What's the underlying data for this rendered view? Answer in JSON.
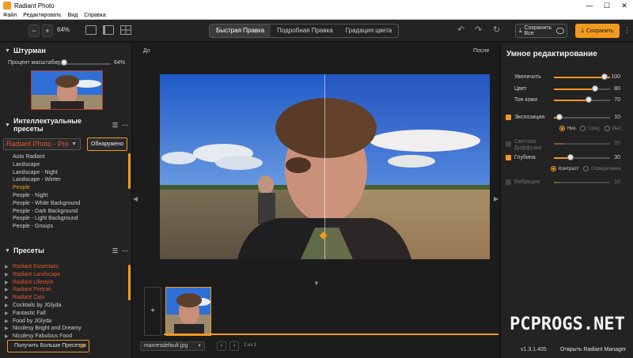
{
  "titlebar": {
    "title": "Radiant Photo",
    "minimize": "—",
    "maximize": "☐",
    "close": "✕"
  },
  "menu": [
    "Файл",
    "Редактировать",
    "Вид",
    "Справка"
  ],
  "toolbar": {
    "zoom_out": "−",
    "zoom_in": "+",
    "zoom_value": "64%",
    "tabs": [
      "Быстрая Правка",
      "Подробная Правка",
      "Градация цвета"
    ],
    "save_all_label": "Сохранить Все",
    "save_label": "Сохранить",
    "more": "⋮"
  },
  "navigator": {
    "title": "Штурман",
    "scale_label": "Процент масштабир",
    "scale_value": "64%",
    "scale_level": 0.1
  },
  "smart_presets": {
    "title": "Интеллектуальные пресеты",
    "selected_pack": "Radiant Photo - Pro",
    "update_button": "Обнаружено",
    "items": [
      "Auto Radiant",
      "Landscape",
      "Landscape - Night",
      "Landscape - Winter",
      "People",
      "People - Night",
      "People - White Background",
      "People - Dark Background",
      "People - Light Background",
      "People - Groups"
    ],
    "selected_index": 4
  },
  "presets": {
    "title": "Пресеты",
    "items": [
      "Radiant Essentials",
      "Radiant Landscape",
      "Radiant Lifestyle",
      "Radiant Portrait",
      "Radiant Cats",
      "Cocktails by JGlyda",
      "Fantastic Fall",
      "Food by JGlyda",
      "Nicolesy Bright and Dreamy",
      "Nicolesy Fabulous Food"
    ],
    "highlighted": [
      0,
      1,
      2,
      3,
      4
    ],
    "more_button": "Получить Больше Пресетов"
  },
  "canvas": {
    "before_label": "До",
    "after_label": "После",
    "file_name": "maxresdefault.jpg",
    "page_text": "1 из 1",
    "add_label": "+"
  },
  "smart_edit": {
    "title": "Умное редактирование",
    "sliders": [
      {
        "label": "Увеличить",
        "value": "100",
        "level": 1.0
      },
      {
        "label": "Цвет",
        "value": "80",
        "level": 0.8
      },
      {
        "label": "Тон кожи",
        "value": "70",
        "level": 0.7
      }
    ],
    "exposure": {
      "label": "Экспозиция",
      "value": "10",
      "level": 0.1,
      "checked": true
    },
    "exposure_modes": [
      "Низ.",
      "Сред.",
      "Выс."
    ],
    "light_diffusion": {
      "label_line1": "Светлая",
      "label_line2": "Диффузия",
      "value": "20",
      "level": 0.2,
      "checked": false
    },
    "depth": {
      "label": "Глубина",
      "value": "30",
      "level": 0.3,
      "checked": true
    },
    "depth_modes": [
      "Контраст",
      "Определение"
    ],
    "vibrance": {
      "label": "Вибрация",
      "value": "10",
      "level": 0.1,
      "checked": false
    }
  },
  "footer": {
    "version": "v1.3.1.405",
    "open_manager": "Открыть Radiant Manager"
  },
  "watermark": "PCPROGS.NET",
  "colors": {
    "accent": "#f29a1f",
    "preset_highlight": "#e0582c",
    "panel": "#232323",
    "canvas": "#1c1c1c"
  }
}
